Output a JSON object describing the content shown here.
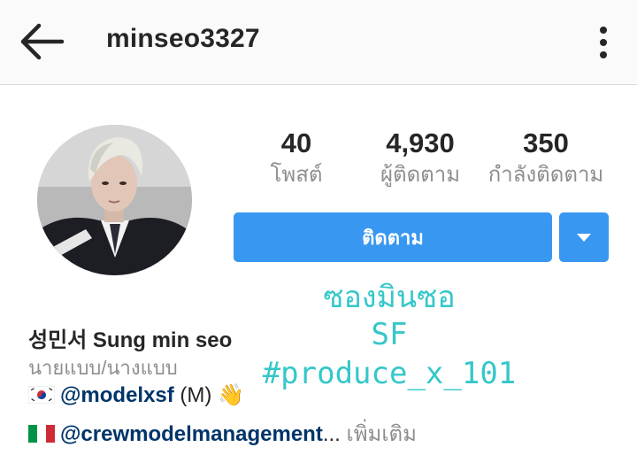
{
  "header": {
    "username": "minseo3327",
    "back_icon": "arrow-left-icon",
    "menu_icon": "more-vertical-icon"
  },
  "stats": [
    {
      "value": "40",
      "label": "โพสต์"
    },
    {
      "value": "4,930",
      "label": "ผู้ติดตาม"
    },
    {
      "value": "350",
      "label": "กำลังติดตาม"
    }
  ],
  "actions": {
    "follow_label": "ติดตาม",
    "dropdown_icon": "caret-down-icon"
  },
  "handwritten": {
    "line1": "ซองมินซอ",
    "line2": "SF",
    "line3": "#produce_x_101"
  },
  "profile": {
    "name": "성민서 Sung min seo",
    "category": "นายแบบ/นางแบบ",
    "bio1_mention": "@modelxsf",
    "bio1_suffix": " (M) ",
    "bio1_emoji": "👋",
    "bio2_mention": "@crewmodelmanagement",
    "bio2_ellipsis": "... ",
    "bio2_more": "เพิ่มเติม"
  },
  "colors": {
    "accent": "#3897f0",
    "handwriting": "#36c7c9",
    "mention": "#003569",
    "secondary_text": "#8e8e8e"
  }
}
